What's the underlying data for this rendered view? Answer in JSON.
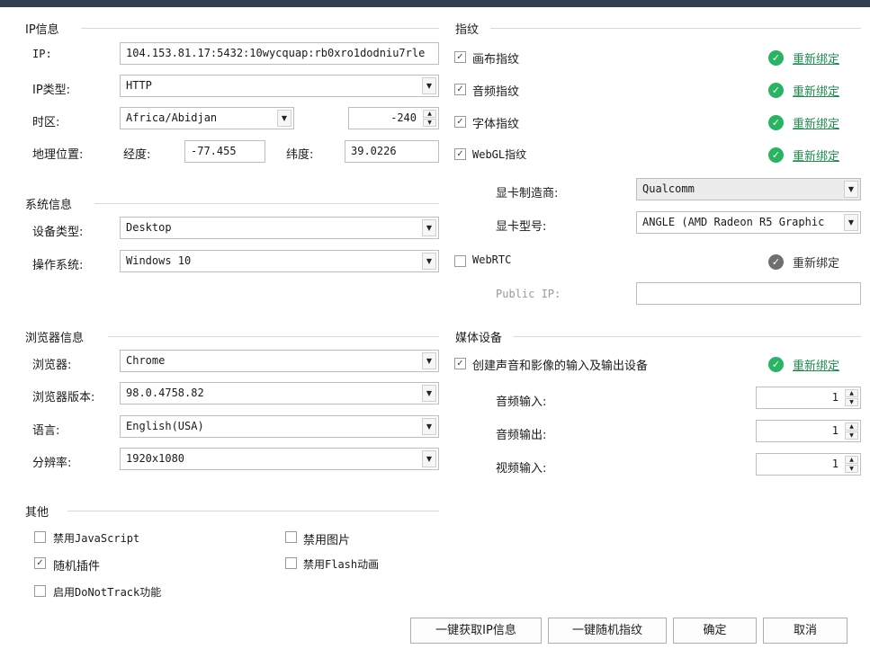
{
  "ip_section": {
    "title": "IP信息",
    "ip_label": "IP:",
    "ip_value": "104.153.81.17:5432:10wycquap:rb0xro1dodniu7rle",
    "ip_type_label": "IP类型:",
    "ip_type_value": "HTTP",
    "timezone_label": "时区:",
    "timezone_value": "Africa/Abidjan",
    "timezone_offset": "-240",
    "geo_label": "地理位置:",
    "longitude_label": "经度:",
    "longitude_value": "-77.455",
    "latitude_label": "纬度:",
    "latitude_value": "39.0226"
  },
  "system_section": {
    "title": "系统信息",
    "device_label": "设备类型:",
    "device_value": "Desktop",
    "os_label": "操作系统:",
    "os_value": "Windows 10"
  },
  "browser_section": {
    "title": "浏览器信息",
    "browser_label": "浏览器:",
    "browser_value": "Chrome",
    "version_label": "浏览器版本:",
    "version_value": "98.0.4758.82",
    "language_label": "语言:",
    "language_value": "English(USA)",
    "resolution_label": "分辨率:",
    "resolution_value": "1920x1080"
  },
  "other_section": {
    "title": "其他",
    "options": [
      {
        "label": "禁用JavaScript",
        "checked": false
      },
      {
        "label": "禁用图片",
        "checked": false
      },
      {
        "label": "随机插件",
        "checked": true
      },
      {
        "label": "禁用Flash动画",
        "checked": false
      },
      {
        "label": "启用DoNotTrack功能",
        "checked": false
      }
    ]
  },
  "fingerprint_section": {
    "title": "指纹",
    "items": [
      {
        "label": "画布指纹",
        "checked": true,
        "rebind": "重新绑定"
      },
      {
        "label": "音频指纹",
        "checked": true,
        "rebind": "重新绑定"
      },
      {
        "label": "字体指纹",
        "checked": true,
        "rebind": "重新绑定"
      },
      {
        "label": "WebGL指纹",
        "checked": true,
        "rebind": "重新绑定"
      }
    ],
    "gpu_vendor_label": "显卡制造商:",
    "gpu_vendor_value": "Qualcomm",
    "gpu_model_label": "显卡型号:",
    "gpu_model_value": "ANGLE (AMD Radeon R5 Graphic",
    "webrtc_label": "WebRTC",
    "webrtc_checked": false,
    "webrtc_rebind": "重新绑定",
    "public_ip_label": "Public IP:",
    "public_ip_value": ""
  },
  "media_section": {
    "title": "媒体设备",
    "create_label": "创建声音和影像的输入及输出设备",
    "create_checked": true,
    "rebind": "重新绑定",
    "audio_in_label": "音频输入:",
    "audio_in_value": "1",
    "audio_out_label": "音频输出:",
    "audio_out_value": "1",
    "video_in_label": "视频输入:",
    "video_in_value": "1"
  },
  "buttons": {
    "get_ip": "一键获取IP信息",
    "random_fp": "一键随机指纹",
    "ok": "确定",
    "cancel": "取消"
  },
  "colors": {
    "accent": "#28b463",
    "topbar": "#2f3e50"
  }
}
